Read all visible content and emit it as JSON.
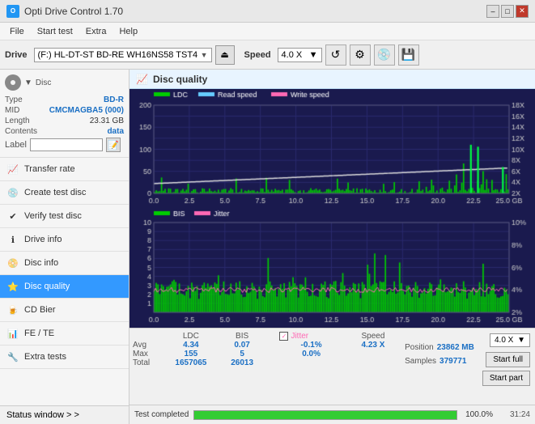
{
  "titleBar": {
    "title": "Opti Drive Control 1.70",
    "icon": "ODC",
    "controls": [
      "minimize",
      "maximize",
      "close"
    ]
  },
  "menuBar": {
    "items": [
      "File",
      "Start test",
      "Extra",
      "Help"
    ]
  },
  "toolbar": {
    "driveLabel": "Drive",
    "driveValue": "(F:)  HL-DT-ST BD-RE  WH16NS58 TST4",
    "speedLabel": "Speed",
    "speedValue": "4.0 X"
  },
  "sidebar": {
    "discPanel": {
      "typeLabel": "Type",
      "typeValue": "BD-R",
      "midLabel": "MID",
      "midValue": "CMCMAGBA5 (000)",
      "lengthLabel": "Length",
      "lengthValue": "23.31 GB",
      "contentsLabel": "Contents",
      "contentsValue": "data",
      "labelLabel": "Label",
      "labelValue": ""
    },
    "navItems": [
      {
        "id": "transfer-rate",
        "label": "Transfer rate",
        "icon": "📈"
      },
      {
        "id": "create-test-disc",
        "label": "Create test disc",
        "icon": "💿"
      },
      {
        "id": "verify-test-disc",
        "label": "Verify test disc",
        "icon": "✔"
      },
      {
        "id": "drive-info",
        "label": "Drive info",
        "icon": "ℹ"
      },
      {
        "id": "disc-info",
        "label": "Disc info",
        "icon": "📀"
      },
      {
        "id": "disc-quality",
        "label": "Disc quality",
        "icon": "⭐",
        "active": true
      },
      {
        "id": "cd-bier",
        "label": "CD Bier",
        "icon": "🍺"
      },
      {
        "id": "fe-te",
        "label": "FE / TE",
        "icon": "📊"
      },
      {
        "id": "extra-tests",
        "label": "Extra tests",
        "icon": "🔧"
      }
    ],
    "statusWindow": "Status window > >"
  },
  "discQuality": {
    "title": "Disc quality",
    "legend": {
      "ldc": "LDC",
      "readSpeed": "Read speed",
      "writeSpeed": "Write speed",
      "bis": "BIS",
      "jitter": "Jitter"
    },
    "topChart": {
      "yMax": 200,
      "yLabels": [
        "200",
        "150",
        "100",
        "50",
        "0.0"
      ],
      "xLabels": [
        "0.0",
        "2.5",
        "5.0",
        "7.5",
        "10.0",
        "12.5",
        "15.0",
        "17.5",
        "20.0",
        "22.5",
        "25.0"
      ],
      "yRightMax": "18X",
      "yRightLabels": [
        "18X",
        "16X",
        "14X",
        "12X",
        "10X",
        "8X",
        "6X",
        "4X",
        "2X"
      ],
      "unit": "GB"
    },
    "bottomChart": {
      "yMax": 10,
      "yLabels": [
        "10",
        "9",
        "8",
        "7",
        "6",
        "5",
        "4",
        "3",
        "2",
        "1"
      ],
      "xLabels": [
        "0.0",
        "2.5",
        "5.0",
        "7.5",
        "10.0",
        "12.5",
        "15.0",
        "17.5",
        "20.0",
        "22.5",
        "25.0"
      ],
      "yRightLabels": [
        "10%",
        "8%",
        "6%",
        "4%",
        "2%"
      ],
      "unit": "GB"
    }
  },
  "stats": {
    "headers": [
      "",
      "LDC",
      "BIS",
      "",
      "Jitter",
      "Speed",
      ""
    ],
    "rows": [
      {
        "label": "Avg",
        "ldc": "4.34",
        "bis": "0.07",
        "jitter": "-0.1%",
        "speed": "4.23 X"
      },
      {
        "label": "Max",
        "ldc": "155",
        "bis": "5",
        "jitter": "0.0%",
        "position": "23862 MB"
      },
      {
        "label": "Total",
        "ldc": "1657065",
        "bis": "26013",
        "jitter": "",
        "samples": "379771"
      }
    ],
    "speedCombo": "4.0 X",
    "buttons": [
      "Start full",
      "Start part"
    ],
    "jitterChecked": true,
    "jitterLabel": "Jitter",
    "positionLabel": "Position",
    "positionValue": "23862 MB",
    "samplesLabel": "Samples",
    "samplesValue": "379771"
  },
  "progressBar": {
    "statusText": "Test completed",
    "percent": "100.0%",
    "percentValue": 100,
    "time": "31:24",
    "fillColor": "#33cc33"
  }
}
